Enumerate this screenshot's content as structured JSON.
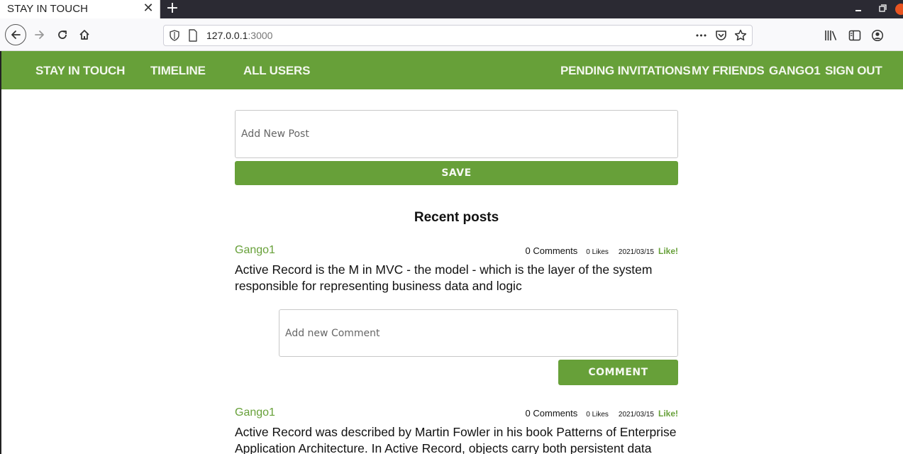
{
  "browser": {
    "tab_title": "STAY IN TOUCH",
    "tab_close": "✕",
    "new_tab": "+",
    "url_host": "127.0.0.1",
    "url_port": ":3000",
    "more_actions": "•••",
    "icons": [
      "back-arrow-icon",
      "forward-arrow-icon",
      "reload-icon",
      "home-icon",
      "shield-icon",
      "page-icon",
      "pocket-icon",
      "bookmark-star-icon",
      "library-icon",
      "sidebar-icon",
      "account-icon"
    ]
  },
  "navbar": {
    "brand": "STAY IN TOUCH",
    "timeline": "TIMELINE",
    "all_users": "ALL USERS",
    "pending_invitations": "PENDING INVITATIONS",
    "my_friends": "MY FRIENDS",
    "current_user": "GANGO1",
    "sign_out": "SIGN OUT"
  },
  "new_post": {
    "placeholder": "Add New Post",
    "save_label": "SAVE"
  },
  "recent_title": "Recent posts",
  "posts": [
    {
      "author": "Gango1",
      "comments": "0 Comments",
      "likes": "0 Likes",
      "date": "2021/03/15",
      "like_link": "Like!",
      "body_line1": "Active Record is the M in MVC - the model - which is the layer of the system",
      "body_line2": "responsible for representing business data and logic"
    },
    {
      "author": "Gango1",
      "comments": "0 Comments",
      "likes": "0 Likes",
      "date": "2021/03/15",
      "like_link": "Like!",
      "body_line1": "Active Record was described by Martin Fowler in his book Patterns of Enterprise",
      "body_line2": "Application Architecture. In Active Record, objects carry both persistent data"
    }
  ],
  "comment_form": {
    "placeholder": "Add new Comment",
    "comment_label": "COMMENT"
  },
  "colors": {
    "brand_green": "#67a039",
    "chrome_dark": "#2b2a33"
  }
}
